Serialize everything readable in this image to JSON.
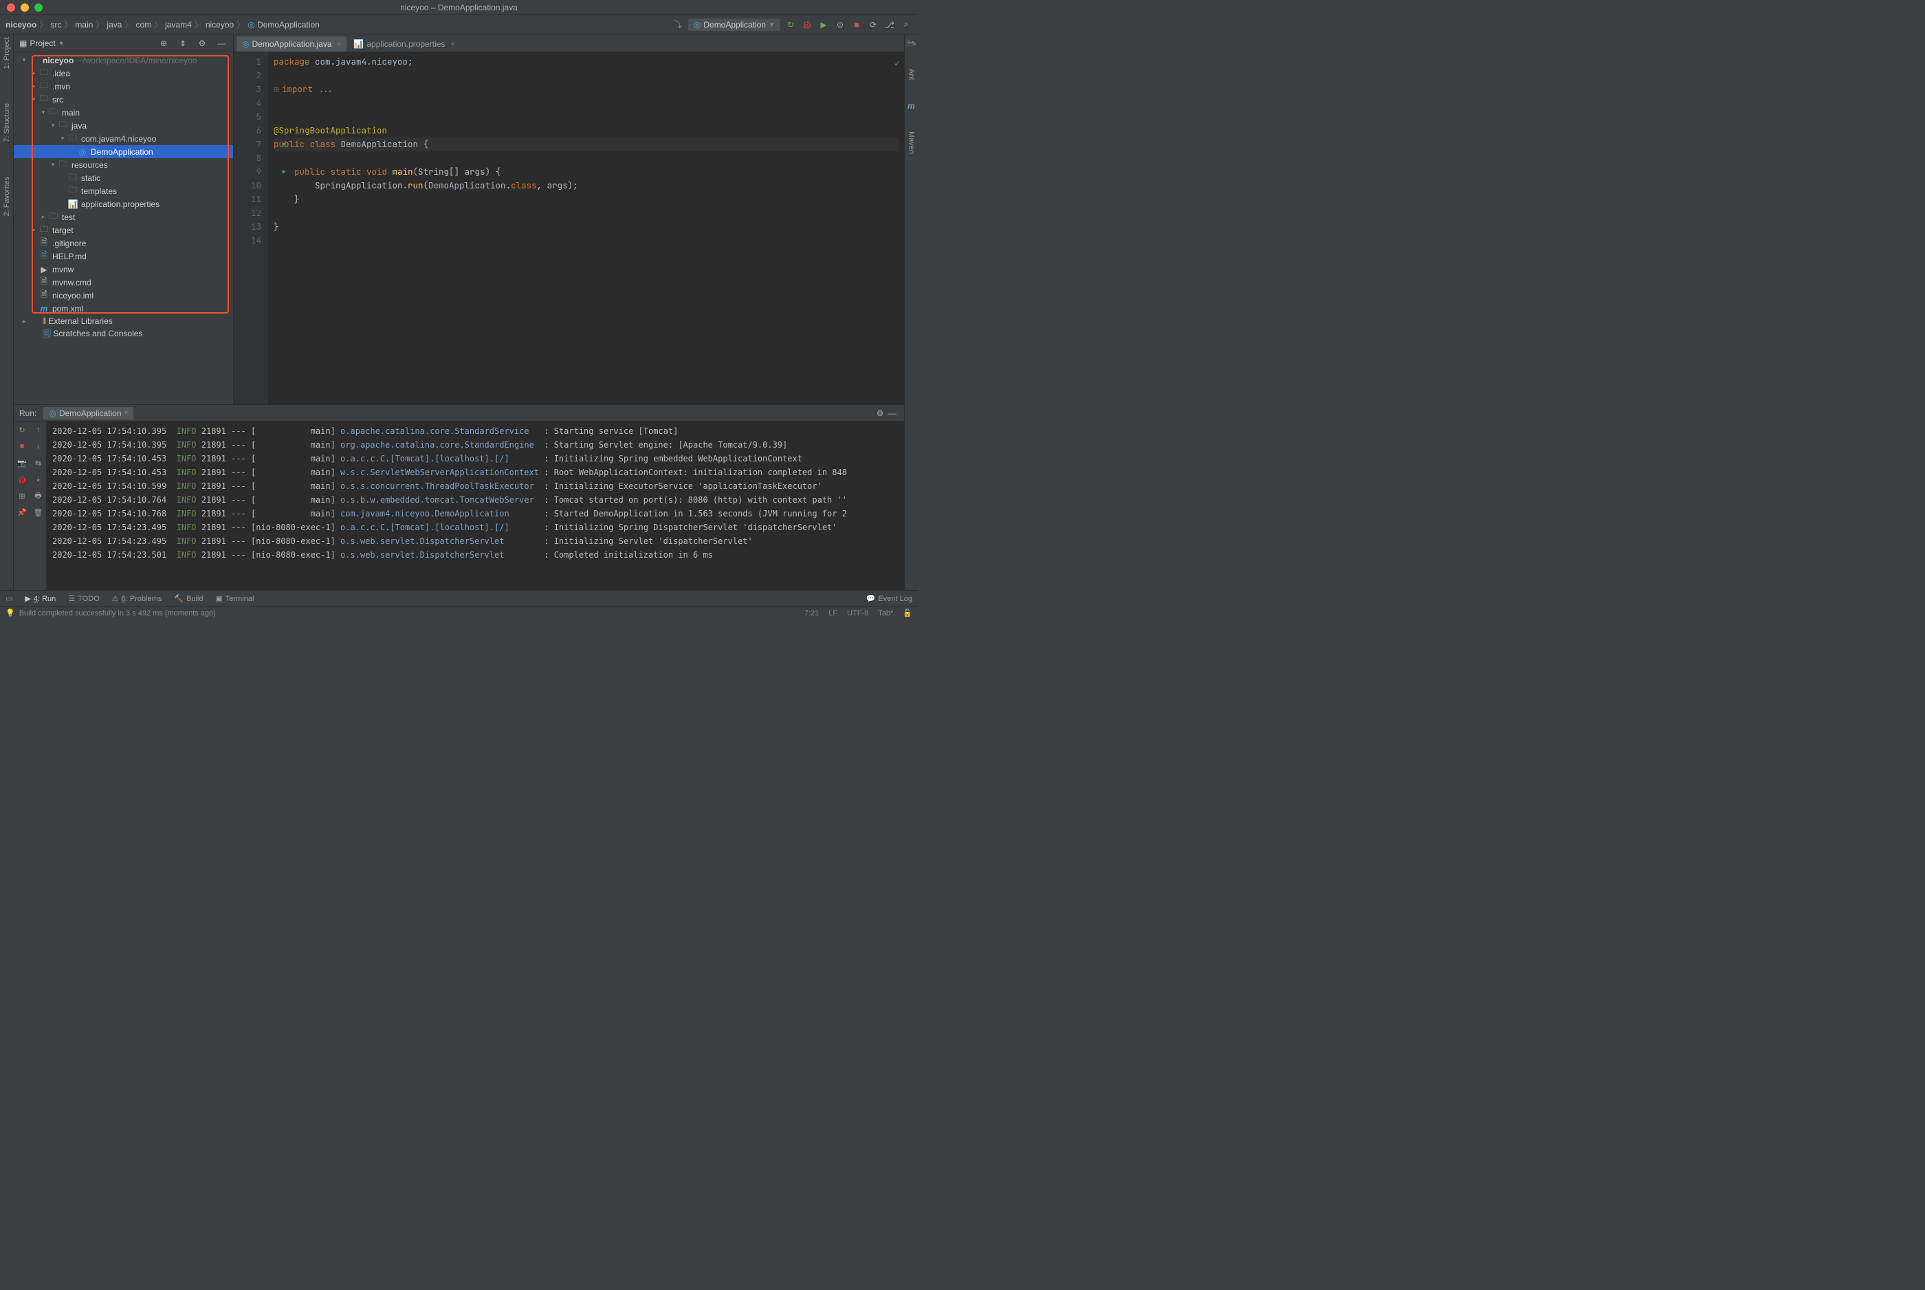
{
  "window": {
    "title": "niceyoo – DemoApplication.java"
  },
  "breadcrumbs": [
    "niceyoo",
    "src",
    "main",
    "java",
    "com",
    "javam4",
    "niceyoo",
    "DemoApplication"
  ],
  "toolbar": {
    "run_config": "DemoApplication"
  },
  "sidebar": {
    "title": "Project",
    "tree": {
      "root": {
        "name": "niceyoo",
        "path": "~/workspace/IDEA/mine/niceyoo"
      },
      "items": [
        {
          "d": 1,
          "arr": "r",
          "ic": "folder",
          "lbl": ".idea"
        },
        {
          "d": 1,
          "arr": "r",
          "ic": "folder",
          "lbl": ".mvn"
        },
        {
          "d": 1,
          "arr": "d",
          "ic": "folder-blue",
          "lbl": "src"
        },
        {
          "d": 2,
          "arr": "d",
          "ic": "folder-blue",
          "lbl": "main"
        },
        {
          "d": 3,
          "arr": "d",
          "ic": "folder-blue",
          "lbl": "java"
        },
        {
          "d": 4,
          "arr": "d",
          "ic": "pkg",
          "lbl": "com.javam4.niceyoo"
        },
        {
          "d": 5,
          "arr": "",
          "ic": "class",
          "lbl": "DemoApplication",
          "sel": true
        },
        {
          "d": 3,
          "arr": "d",
          "ic": "res",
          "lbl": "resources"
        },
        {
          "d": 4,
          "arr": "",
          "ic": "folder",
          "lbl": "static"
        },
        {
          "d": 4,
          "arr": "",
          "ic": "folder",
          "lbl": "templates"
        },
        {
          "d": 4,
          "arr": "",
          "ic": "props",
          "lbl": "application.properties"
        },
        {
          "d": 2,
          "arr": "r",
          "ic": "folder",
          "lbl": "test"
        },
        {
          "d": 1,
          "arr": "r",
          "ic": "folder-orange",
          "lbl": "target"
        },
        {
          "d": 1,
          "arr": "",
          "ic": "file",
          "lbl": ".gitignore"
        },
        {
          "d": 1,
          "arr": "",
          "ic": "md",
          "lbl": "HELP.md"
        },
        {
          "d": 1,
          "arr": "",
          "ic": "sh",
          "lbl": "mvnw"
        },
        {
          "d": 1,
          "arr": "",
          "ic": "file",
          "lbl": "mvnw.cmd"
        },
        {
          "d": 1,
          "arr": "",
          "ic": "iml",
          "lbl": "niceyoo.iml"
        },
        {
          "d": 1,
          "arr": "",
          "ic": "maven",
          "lbl": "pom.xml"
        }
      ],
      "ext_lib": "External Libraries",
      "scratches": "Scratches and Consoles"
    }
  },
  "tabs": [
    {
      "label": "DemoApplication.java",
      "ic": "class",
      "active": true
    },
    {
      "label": "application.properties",
      "ic": "props",
      "active": false
    }
  ],
  "code": {
    "1": {
      "t": "package com.javam4.niceyoo;",
      "tokens": [
        [
          "kw",
          "package "
        ],
        [
          "pkg",
          "com.javam4.niceyoo"
        ],
        [
          "",
          ";"
        ]
      ]
    },
    "2": {
      "t": ""
    },
    "3": {
      "t": "import ...",
      "tokens": [
        [
          "kw",
          "import "
        ],
        [
          "comm",
          "..."
        ]
      ],
      "fold": true
    },
    "4": {
      "t": ""
    },
    "5": {
      "t": ""
    },
    "6": {
      "t": "@SpringBootApplication",
      "tokens": [
        [
          "ann",
          "@SpringBootApplication"
        ]
      ]
    },
    "7": {
      "t": "public class DemoApplication {",
      "tokens": [
        [
          "kw",
          "public class "
        ],
        [
          "cls",
          "DemoApplication"
        ],
        [
          "",
          " {"
        ]
      ],
      "run": true,
      "cur": true
    },
    "8": {
      "t": ""
    },
    "9": {
      "t": "    public static void main(String[] args) {",
      "tokens": [
        [
          "",
          "    "
        ],
        [
          "kw",
          "public static void "
        ],
        [
          "fn",
          "main"
        ],
        [
          "",
          "(String[] args) {"
        ]
      ],
      "run": true
    },
    "10": {
      "t": "        SpringApplication.run(DemoApplication.class, args);",
      "tokens": [
        [
          "",
          "        SpringApplication."
        ],
        [
          "fn",
          "run"
        ],
        [
          "",
          "("
        ],
        [
          "cls",
          "DemoApplication"
        ],
        [
          "",
          "."
        ],
        [
          "kw",
          "class"
        ],
        [
          "",
          ", args);"
        ]
      ]
    },
    "11": {
      "t": "    }"
    },
    "12": {
      "t": ""
    },
    "13": {
      "t": "}"
    },
    "14": {
      "t": ""
    }
  },
  "run": {
    "title": "Run:",
    "tab": "DemoApplication",
    "log": [
      {
        "ts": "2020-12-05 17:54:10.395",
        "lvl": "INFO",
        "pid": "21891",
        "thr": "main",
        "cls": "o.apache.catalina.core.StandardService",
        "msg": "Starting service [Tomcat]"
      },
      {
        "ts": "2020-12-05 17:54:10.395",
        "lvl": "INFO",
        "pid": "21891",
        "thr": "main",
        "cls": "org.apache.catalina.core.StandardEngine",
        "msg": "Starting Servlet engine: [Apache Tomcat/9.0.39]"
      },
      {
        "ts": "2020-12-05 17:54:10.453",
        "lvl": "INFO",
        "pid": "21891",
        "thr": "main",
        "cls": "o.a.c.c.C.[Tomcat].[localhost].[/]",
        "msg": "Initializing Spring embedded WebApplicationContext"
      },
      {
        "ts": "2020-12-05 17:54:10.453",
        "lvl": "INFO",
        "pid": "21891",
        "thr": "main",
        "cls": "w.s.c.ServletWebServerApplicationContext",
        "msg": "Root WebApplicationContext: initialization completed in 848"
      },
      {
        "ts": "2020-12-05 17:54:10.599",
        "lvl": "INFO",
        "pid": "21891",
        "thr": "main",
        "cls": "o.s.s.concurrent.ThreadPoolTaskExecutor",
        "msg": "Initializing ExecutorService 'applicationTaskExecutor'"
      },
      {
        "ts": "2020-12-05 17:54:10.764",
        "lvl": "INFO",
        "pid": "21891",
        "thr": "main",
        "cls": "o.s.b.w.embedded.tomcat.TomcatWebServer",
        "msg": "Tomcat started on port(s): 8080 (http) with context path ''"
      },
      {
        "ts": "2020-12-05 17:54:10.768",
        "lvl": "INFO",
        "pid": "21891",
        "thr": "main",
        "cls": "com.javam4.niceyoo.DemoApplication",
        "msg": "Started DemoApplication in 1.563 seconds (JVM running for 2"
      },
      {
        "ts": "2020-12-05 17:54:23.495",
        "lvl": "INFO",
        "pid": "21891",
        "thr": "nio-8080-exec-1",
        "cls": "o.a.c.c.C.[Tomcat].[localhost].[/]",
        "msg": "Initializing Spring DispatcherServlet 'dispatcherServlet'"
      },
      {
        "ts": "2020-12-05 17:54:23.495",
        "lvl": "INFO",
        "pid": "21891",
        "thr": "nio-8080-exec-1",
        "cls": "o.s.web.servlet.DispatcherServlet",
        "msg": "Initializing Servlet 'dispatcherServlet'"
      },
      {
        "ts": "2020-12-05 17:54:23.501",
        "lvl": "INFO",
        "pid": "21891",
        "thr": "nio-8080-exec-1",
        "cls": "o.s.web.servlet.DispatcherServlet",
        "msg": "Completed initialization in 6 ms"
      }
    ]
  },
  "bottom_tabs": [
    {
      "ic": "▶",
      "lbl": "4: Run",
      "active": true,
      "underline": "4"
    },
    {
      "ic": "☰",
      "lbl": "TODO"
    },
    {
      "ic": "⚠",
      "lbl": "6: Problems",
      "underline": "6"
    },
    {
      "ic": "🔨",
      "lbl": "Build"
    },
    {
      "ic": "▣",
      "lbl": "Terminal"
    }
  ],
  "event_log": "Event Log",
  "status": {
    "msg": "Build completed successfully in 3 s 492 ms (moments ago)",
    "pos": "7:21",
    "le": "LF",
    "enc": "UTF-8",
    "indent": "Tab*"
  },
  "left_strip": [
    "1: Project",
    "7: Structure",
    "2: Favorites"
  ],
  "right_strip": [
    "Ant",
    "Maven"
  ]
}
